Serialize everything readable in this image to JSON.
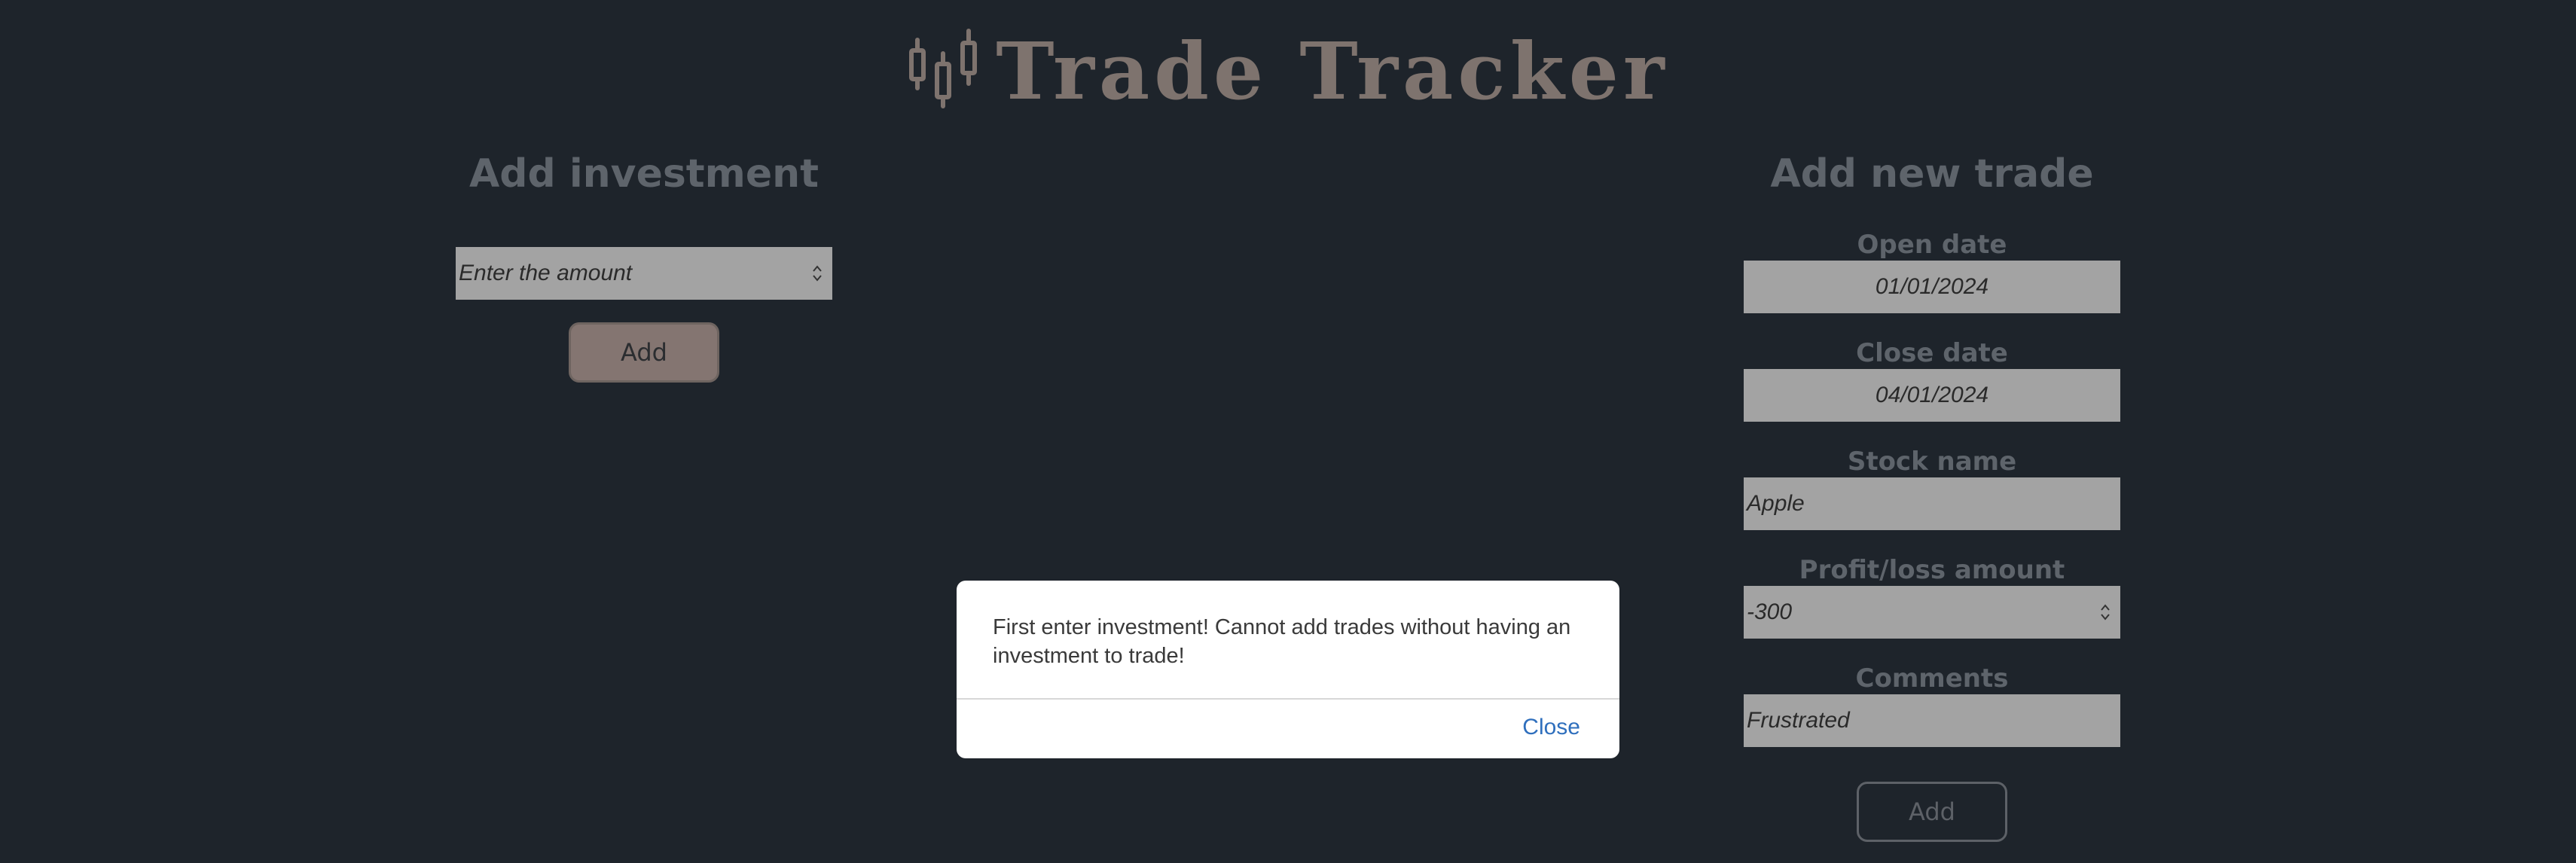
{
  "header": {
    "title": "Trade Tracker",
    "logo_icon": "candlestick-chart-icon"
  },
  "investment": {
    "title": "Add investment",
    "amount_placeholder": "Enter the amount",
    "add_label": "Add"
  },
  "trade": {
    "title": "Add new trade",
    "open_date_label": "Open date",
    "open_date_value": "01/01/2024",
    "close_date_label": "Close date",
    "close_date_value": "04/01/2024",
    "stock_name_label": "Stock name",
    "stock_name_value": "Apple",
    "profit_loss_label": "Profit/loss amount",
    "profit_loss_value": "-300",
    "comments_label": "Comments",
    "comments_value": "Frustrated",
    "add_label": "Add"
  },
  "modal": {
    "message": "First enter investment! Cannot add trades without having an investment to trade!",
    "close_label": "Close"
  },
  "colors": {
    "background": "#1e242b",
    "title": "#7e736e",
    "section_title": "#5e646b",
    "input_bg": "#a3a3a3",
    "invest_button": "#847571",
    "modal_link": "#2f6fbd"
  }
}
